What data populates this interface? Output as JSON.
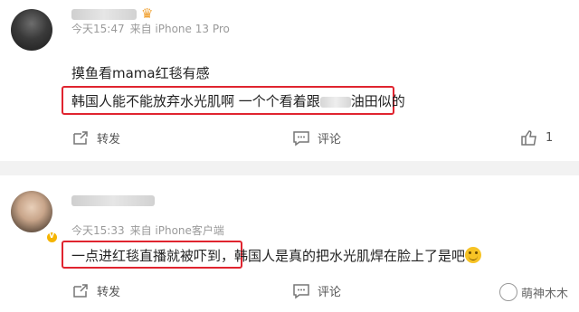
{
  "comments": [
    {
      "meta_time": "今天15:47",
      "meta_source": "来自 iPhone 13 Pro",
      "line1": "摸鱼看mama红毯有感",
      "line2_a": "韩国人能不能放弃水光肌啊 一个个看着跟",
      "line2_b": "油田",
      "line2_c": "似的",
      "actions": {
        "repost": "转发",
        "comment": "评论",
        "like_count": "1"
      }
    },
    {
      "meta_time": "今天15:33",
      "meta_source": "来自 iPhone客户端",
      "line1_a": "一点进红毯直播就被吓到，",
      "line1_b": "韩国人是真的把水光肌焊在脸上了是吧",
      "actions": {
        "repost": "转发",
        "comment": "评论"
      }
    }
  ],
  "watermark": "萌神木木",
  "colors": {
    "highlight": "#e0242f",
    "meta": "#9a9a9a",
    "divider": "#f2f2f2"
  }
}
